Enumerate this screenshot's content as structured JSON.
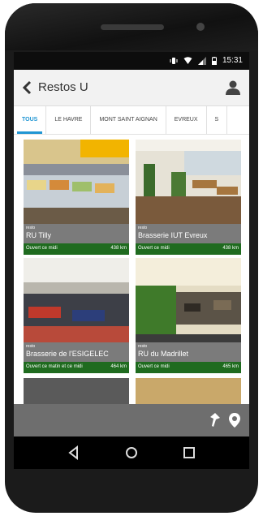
{
  "status": {
    "time": "15:31"
  },
  "appbar": {
    "title": "Restos U"
  },
  "tabs": [
    {
      "label": "TOUS",
      "active": true
    },
    {
      "label": "LE HAVRE",
      "active": false
    },
    {
      "label": "MONT SAINT AIGNAN",
      "active": false
    },
    {
      "label": "EVREUX",
      "active": false
    },
    {
      "label": "S",
      "active": false
    }
  ],
  "cards": [
    {
      "kind": "resto",
      "name": "RU Tilly",
      "hours": "Ouvert ce midi",
      "distance": "438 km"
    },
    {
      "kind": "resto",
      "name": "Brasserie IUT Evreux",
      "hours": "Ouvert ce midi",
      "distance": "438 km"
    },
    {
      "kind": "resto",
      "name": "Brasserie de l'ESIGELEC",
      "hours": "Ouvert ce matin et ce midi",
      "distance": "464 km"
    },
    {
      "kind": "resto",
      "name": "RU du Madrillet",
      "hours": "Ouvert ce midi",
      "distance": "465 km"
    }
  ],
  "colors": {
    "accent": "#2196d3",
    "open_bar": "#1f6b1f"
  },
  "icons": [
    "back-arrow-icon",
    "user-icon",
    "wifi-icon",
    "signal-icon",
    "battery-icon",
    "route-pin-icon",
    "location-pin-icon",
    "nav-back-icon",
    "nav-home-icon",
    "nav-recents-icon"
  ]
}
